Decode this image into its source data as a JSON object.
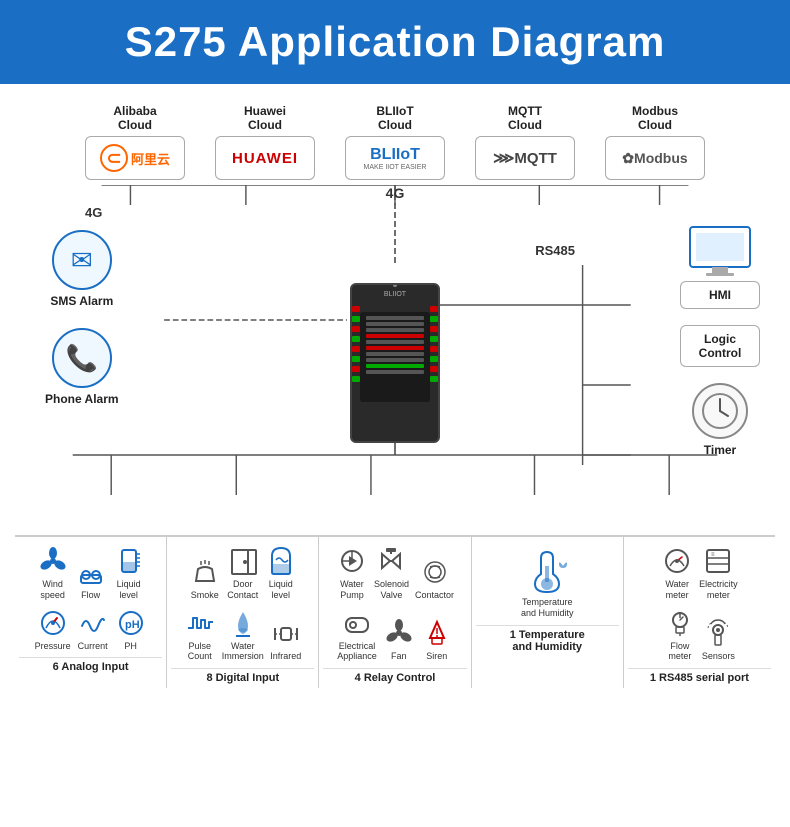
{
  "header": {
    "title": "S275 Application Diagram"
  },
  "clouds": [
    {
      "label": "Alibaba\nCloud",
      "logo_type": "alibaba"
    },
    {
      "label": "Huawei\nCloud",
      "logo_type": "huawei"
    },
    {
      "label": "BLIIoT\nCloud",
      "logo_type": "bliiot"
    },
    {
      "label": "MQTT\nCloud",
      "logo_type": "mqtt"
    },
    {
      "label": "Modbus\nCloud",
      "logo_type": "modbus"
    }
  ],
  "connections": {
    "top_label": "4G",
    "left_label": "4G",
    "rs485_label": "RS485"
  },
  "left_alarms": [
    {
      "label": "SMS Alarm",
      "icon": "✉"
    },
    {
      "label": "Phone Alarm",
      "icon": "📞"
    }
  ],
  "right_items": [
    {
      "label": "HMI",
      "type": "monitor"
    },
    {
      "label": "Logic\nControl",
      "type": "box"
    },
    {
      "label": "Timer",
      "type": "clock"
    }
  ],
  "bottom_groups": [
    {
      "label": "6 Analog Input",
      "row1": [
        {
          "icon": "fan",
          "label": "Wind\nspeed"
        },
        {
          "icon": "flow",
          "label": "Flow"
        },
        {
          "icon": "liquid",
          "label": "Liquid\nlevel"
        }
      ],
      "row2": [
        {
          "icon": "pressure",
          "label": "Pressure"
        },
        {
          "icon": "current",
          "label": "Current"
        },
        {
          "icon": "ph",
          "label": "PH"
        }
      ]
    },
    {
      "label": "8 Digital Input",
      "row1": [
        {
          "icon": "smoke",
          "label": "Smoke"
        },
        {
          "icon": "door",
          "label": "Door\nContact"
        },
        {
          "icon": "liquidlevel",
          "label": "Liquid\nlevel"
        }
      ],
      "row2": [
        {
          "icon": "pulse",
          "label": "Pulse\nCount"
        },
        {
          "icon": "water",
          "label": "Water\nImmersion"
        },
        {
          "icon": "infrared",
          "label": "Infrared"
        }
      ]
    },
    {
      "label": "4 Relay Control",
      "row1": [
        {
          "icon": "pump",
          "label": "Water\nPump"
        },
        {
          "icon": "valve",
          "label": "Solenoid\nValve"
        },
        {
          "icon": "contactor",
          "label": "Contactor"
        }
      ],
      "row2": [
        {
          "icon": "appliance",
          "label": "Electrical\nAppliance"
        },
        {
          "icon": "fann",
          "label": "Fan"
        },
        {
          "icon": "siren",
          "label": "Siren"
        }
      ]
    },
    {
      "label": "1 Temperature\nand Humidity",
      "row1": [
        {
          "icon": "temphum",
          "label": "Temperature\nand Humidity"
        }
      ],
      "row2": []
    },
    {
      "label": "1 RS485 serial port",
      "row1": [
        {
          "icon": "watermeter",
          "label": "Water\nmeter"
        },
        {
          "icon": "electricity",
          "label": "Electricity\nmeter"
        }
      ],
      "row2": [
        {
          "icon": "flowmeter",
          "label": "Flow\nmeter"
        },
        {
          "icon": "sensors",
          "label": "Sensors"
        }
      ]
    }
  ]
}
